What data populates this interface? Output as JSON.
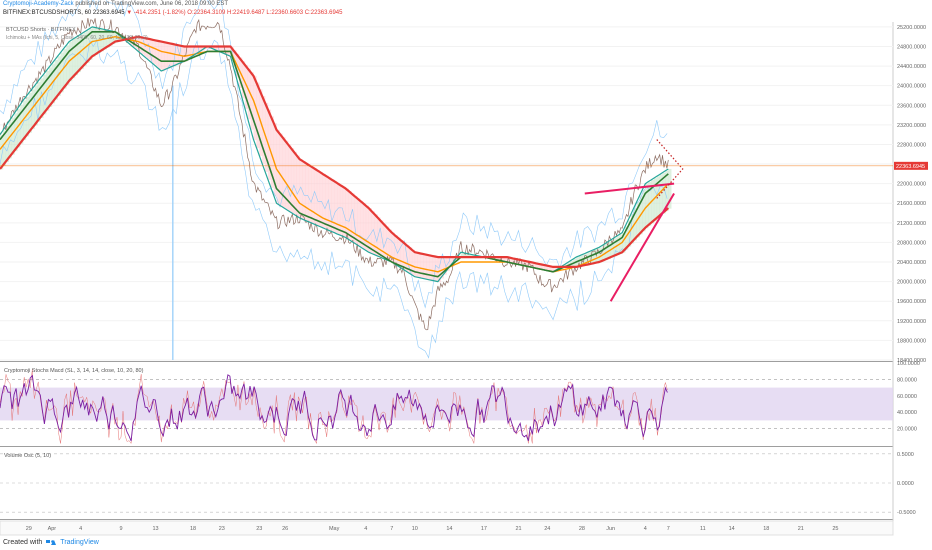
{
  "header": {
    "author": "Cryptomoji-Academy-Zack",
    "published": "published on TradingView.com, June 06, 2018 09:00 EST",
    "symbol": "BITFINEX:BTCUSDSHORTS, 60",
    "last": "22363.6945",
    "change": "▼ -414.2351 (-1.82%)",
    "open": "O:22364.3109",
    "high": "H:22419.6487",
    "low": "L:22360.6603",
    "close": "C:22363.6945"
  },
  "footer": {
    "created_with": "Created with",
    "brand": "TradingView"
  },
  "colors": {
    "price": "#8d6e63",
    "ema_fast": "#26a69a",
    "ema_mid": "#2e7d32",
    "ema_slow": "#ff9800",
    "ema_long": "#e53935",
    "cloud_up": "#c8e6c9",
    "cloud_dn": "#ffcdd2",
    "bands": "#90caf9",
    "wedge": "#e91e63",
    "stoch_k": "#7b1fa2",
    "stoch_d": "#e57373",
    "stoch_band": "#e1d5f0"
  },
  "chart_data": [
    {
      "type": "line",
      "pane": "price",
      "title": "BTCUSD Shorts · BITFINEX",
      "subtitle": "Ichimoku + MAs (Ichi, 5, Close, 3400, 60, 20, 60, 120, 30, 20, 2)",
      "ylim": [
        18400,
        25300
      ],
      "yticks": [
        18400,
        18800,
        19200,
        19600,
        20000,
        20400,
        20800,
        21200,
        21600,
        22000,
        22400,
        22800,
        23200,
        23600,
        24000,
        24400,
        24800,
        25200
      ],
      "ytick_labels": [
        "18400.0000",
        "18800.0000",
        "19200.0000",
        "19600.0000",
        "20000.0000",
        "20400.0000",
        "20800.0000",
        "21200.0000",
        "21600.0000",
        "22000.0000",
        "22400.0000",
        "22800.0000",
        "23200.0000",
        "23600.0000",
        "24000.0000",
        "24400.0000",
        "24800.0000",
        "25200.0000"
      ],
      "last_price_label": "22363.6945",
      "last_price": 22363.69,
      "xlim": [
        0,
        100
      ],
      "x_ticks": [
        {
          "x": 5,
          "label": "29"
        },
        {
          "x": 9,
          "label": "Apr"
        },
        {
          "x": 14,
          "label": "4"
        },
        {
          "x": 21,
          "label": "9"
        },
        {
          "x": 27,
          "label": "13"
        },
        {
          "x": 33.5,
          "label": "18"
        },
        {
          "x": 38.5,
          "label": "23"
        },
        {
          "x": 45,
          "label": "23"
        },
        {
          "x": 49.5,
          "label": "26"
        },
        {
          "x": 58,
          "label": "May"
        },
        {
          "x": 63.5,
          "label": "4"
        },
        {
          "x": 68,
          "label": "7"
        },
        {
          "x": 72,
          "label": "10"
        },
        {
          "x": 78,
          "label": "14"
        },
        {
          "x": 84,
          "label": "17"
        },
        {
          "x": 90,
          "label": "21"
        },
        {
          "x": 95,
          "label": "24"
        },
        {
          "x": 101,
          "label": "28"
        },
        {
          "x": 106,
          "label": "Jun"
        },
        {
          "x": 112,
          "label": "4"
        },
        {
          "x": 116,
          "label": "7"
        },
        {
          "x": 122,
          "label": "11"
        },
        {
          "x": 127,
          "label": "14"
        },
        {
          "x": 133,
          "label": "18"
        },
        {
          "x": 139,
          "label": "21"
        },
        {
          "x": 145,
          "label": "25"
        }
      ],
      "xdomain": [
        0,
        155
      ],
      "series": [
        {
          "key": "price",
          "x": [
            0,
            4,
            8,
            12,
            16,
            20,
            24,
            28,
            30,
            34,
            38,
            40,
            44,
            48,
            52,
            56,
            60,
            64,
            68,
            70,
            72,
            74,
            76,
            78,
            80,
            84,
            88,
            92,
            94,
            96,
            100,
            104,
            106,
            108,
            110,
            112,
            114,
            116
          ],
          "values": [
            23000,
            23800,
            24400,
            25100,
            25300,
            25200,
            24800,
            23600,
            24000,
            25200,
            25300,
            24400,
            22000,
            21200,
            21300,
            21000,
            20900,
            20400,
            20400,
            20200,
            19500,
            19000,
            19800,
            20100,
            20700,
            20600,
            20400,
            20300,
            20000,
            19900,
            20300,
            20600,
            20900,
            21000,
            21800,
            22300,
            22600,
            22360
          ]
        },
        {
          "key": "ema_fast",
          "x": [
            0,
            4,
            8,
            12,
            16,
            20,
            24,
            28,
            32,
            36,
            40,
            44,
            48,
            52,
            56,
            60,
            64,
            68,
            72,
            76,
            80,
            84,
            88,
            92,
            96,
            100,
            104,
            108,
            112,
            116
          ],
          "values": [
            23000,
            23700,
            24300,
            24900,
            25200,
            25100,
            24700,
            24300,
            24500,
            24800,
            24600,
            22900,
            21600,
            21300,
            21100,
            20900,
            20600,
            20400,
            20100,
            20000,
            20600,
            20500,
            20400,
            20300,
            20200,
            20500,
            20700,
            21000,
            22000,
            22300
          ]
        },
        {
          "key": "ema_mid",
          "x": [
            0,
            4,
            8,
            12,
            16,
            20,
            24,
            28,
            32,
            36,
            40,
            44,
            48,
            52,
            56,
            60,
            64,
            68,
            72,
            76,
            80,
            84,
            88,
            92,
            96,
            100,
            104,
            108,
            112,
            116
          ],
          "values": [
            22900,
            23500,
            24100,
            24700,
            25100,
            25100,
            24800,
            24500,
            24500,
            24700,
            24700,
            23300,
            21900,
            21400,
            21200,
            21000,
            20700,
            20400,
            20200,
            20100,
            20500,
            20500,
            20400,
            20300,
            20200,
            20400,
            20600,
            20900,
            21800,
            22200
          ]
        },
        {
          "key": "ema_slow",
          "x": [
            0,
            4,
            8,
            12,
            16,
            20,
            24,
            28,
            32,
            36,
            40,
            44,
            48,
            52,
            56,
            60,
            64,
            68,
            72,
            76,
            80,
            84,
            88,
            92,
            96,
            100,
            104,
            108,
            112,
            116
          ],
          "values": [
            22700,
            23300,
            23900,
            24500,
            24900,
            25000,
            24900,
            24700,
            24600,
            24700,
            24700,
            23700,
            22300,
            21600,
            21300,
            21100,
            20800,
            20500,
            20300,
            20200,
            20400,
            20400,
            20400,
            20300,
            20200,
            20300,
            20500,
            20800,
            21500,
            22000
          ]
        },
        {
          "key": "ema_long",
          "x": [
            0,
            4,
            8,
            12,
            16,
            20,
            24,
            28,
            32,
            36,
            40,
            44,
            48,
            52,
            56,
            60,
            64,
            68,
            72,
            76,
            80,
            84,
            88,
            92,
            96,
            100,
            104,
            108,
            112,
            116
          ],
          "values": [
            22300,
            22900,
            23500,
            24100,
            24600,
            24900,
            25000,
            24900,
            24800,
            24800,
            24800,
            24200,
            23100,
            22500,
            22200,
            21900,
            21500,
            21000,
            20600,
            20500,
            20500,
            20500,
            20500,
            20400,
            20300,
            20300,
            20400,
            20600,
            21100,
            21500
          ]
        }
      ],
      "annotations": [
        {
          "type": "line",
          "color_key": "wedge",
          "x": [
            101.5,
            117
          ],
          "y": [
            21800,
            22000
          ]
        },
        {
          "type": "line",
          "color_key": "wedge",
          "x": [
            106,
            117
          ],
          "y": [
            19600,
            21800
          ]
        }
      ]
    },
    {
      "type": "line",
      "pane": "stoch",
      "title": "Cryptomoji Stochs Macd (SL, 3, 14, 14, close, 10, 20, 80)",
      "ylim": [
        0,
        100
      ],
      "yticks": [
        20,
        40,
        60,
        80,
        100
      ],
      "ytick_labels": [
        "20.0000",
        "40.0000",
        "60.0000",
        "80.0000",
        "100.0000"
      ],
      "band": [
        30,
        70
      ],
      "levels": [
        20,
        80
      ]
    },
    {
      "type": "line",
      "pane": "volume_osc",
      "title": "Volume Osc (5, 10)",
      "ylim": [
        -0.6,
        0.6
      ],
      "yticks": [
        0.5,
        0,
        -0.5
      ],
      "ytick_labels": [
        "0.5000",
        "0.0000",
        "-0.5000"
      ]
    }
  ]
}
